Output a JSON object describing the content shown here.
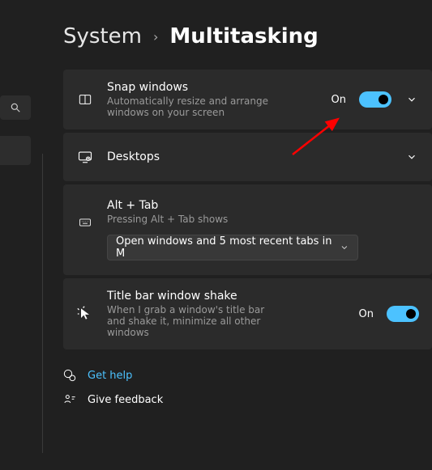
{
  "breadcrumb": {
    "parent": "System",
    "sep": "›",
    "current": "Multitasking"
  },
  "sections": {
    "snap": {
      "title": "Snap windows",
      "subtitle": "Automatically resize and arrange windows on your screen",
      "state": "On"
    },
    "desktops": {
      "title": "Desktops"
    },
    "alttab": {
      "title": "Alt + Tab",
      "subtitle": "Pressing Alt + Tab shows",
      "dropdown": "Open windows and 5 most recent tabs in M"
    },
    "shake": {
      "title": "Title bar window shake",
      "subtitle": "When I grab a window's title bar and shake it, minimize all other windows",
      "state": "On"
    }
  },
  "links": {
    "help": "Get help",
    "feedback": "Give feedback"
  }
}
